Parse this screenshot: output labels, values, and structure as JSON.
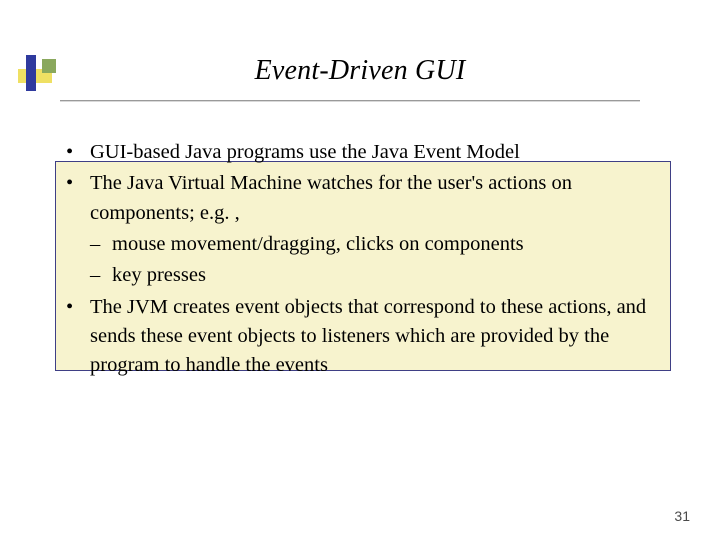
{
  "title": "Event-Driven GUI",
  "bullets": {
    "b1": "GUI-based Java programs use the Java Event Model",
    "b2": "The Java Virtual Machine watches for the user's actions on components; e.g. ,",
    "b2a": "mouse movement/dragging, clicks on components",
    "b2b": "key presses",
    "b3": "The JVM creates event objects that correspond to these actions, and sends these event objects to listeners which are provided by the program to handle the events"
  },
  "page_number": "31"
}
